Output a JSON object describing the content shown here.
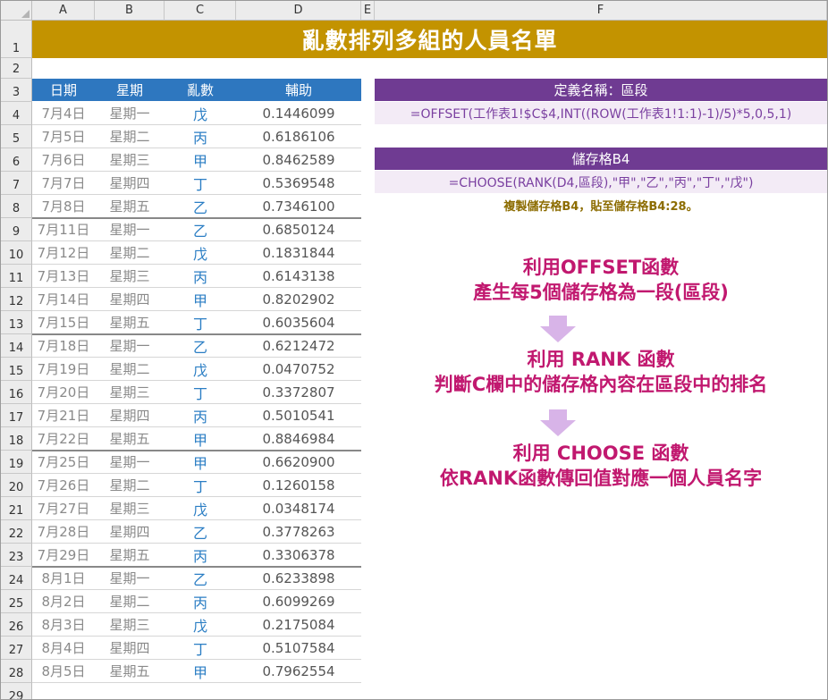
{
  "columns": [
    "A",
    "B",
    "C",
    "D",
    "E",
    "F"
  ],
  "rows": [
    "1",
    "2",
    "3",
    "4",
    "5",
    "6",
    "7",
    "8",
    "9",
    "10",
    "11",
    "12",
    "13",
    "14",
    "15",
    "16",
    "17",
    "18",
    "19",
    "20",
    "21",
    "22",
    "23",
    "24",
    "25",
    "26",
    "27",
    "28",
    "29"
  ],
  "title": "亂數排列多組的人員名單",
  "table": {
    "headers": [
      "日期",
      "星期",
      "亂數",
      "輔助"
    ],
    "rows": [
      {
        "date": "7月4日",
        "week": "星期一",
        "rand": "戊",
        "help": "0.1446099"
      },
      {
        "date": "7月5日",
        "week": "星期二",
        "rand": "丙",
        "help": "0.6186106"
      },
      {
        "date": "7月6日",
        "week": "星期三",
        "rand": "甲",
        "help": "0.8462589"
      },
      {
        "date": "7月7日",
        "week": "星期四",
        "rand": "丁",
        "help": "0.5369548"
      },
      {
        "date": "7月8日",
        "week": "星期五",
        "rand": "乙",
        "help": "0.7346100"
      },
      {
        "date": "7月11日",
        "week": "星期一",
        "rand": "乙",
        "help": "0.6850124"
      },
      {
        "date": "7月12日",
        "week": "星期二",
        "rand": "戊",
        "help": "0.1831844"
      },
      {
        "date": "7月13日",
        "week": "星期三",
        "rand": "丙",
        "help": "0.6143138"
      },
      {
        "date": "7月14日",
        "week": "星期四",
        "rand": "甲",
        "help": "0.8202902"
      },
      {
        "date": "7月15日",
        "week": "星期五",
        "rand": "丁",
        "help": "0.6035604"
      },
      {
        "date": "7月18日",
        "week": "星期一",
        "rand": "乙",
        "help": "0.6212472"
      },
      {
        "date": "7月19日",
        "week": "星期二",
        "rand": "戊",
        "help": "0.0470752"
      },
      {
        "date": "7月20日",
        "week": "星期三",
        "rand": "丁",
        "help": "0.3372807"
      },
      {
        "date": "7月21日",
        "week": "星期四",
        "rand": "丙",
        "help": "0.5010541"
      },
      {
        "date": "7月22日",
        "week": "星期五",
        "rand": "甲",
        "help": "0.8846984"
      },
      {
        "date": "7月25日",
        "week": "星期一",
        "rand": "甲",
        "help": "0.6620900"
      },
      {
        "date": "7月26日",
        "week": "星期二",
        "rand": "丁",
        "help": "0.1260158"
      },
      {
        "date": "7月27日",
        "week": "星期三",
        "rand": "戊",
        "help": "0.0348174"
      },
      {
        "date": "7月28日",
        "week": "星期四",
        "rand": "乙",
        "help": "0.3778263"
      },
      {
        "date": "7月29日",
        "week": "星期五",
        "rand": "丙",
        "help": "0.3306378"
      },
      {
        "date": "8月1日",
        "week": "星期一",
        "rand": "乙",
        "help": "0.6233898"
      },
      {
        "date": "8月2日",
        "week": "星期二",
        "rand": "丙",
        "help": "0.6099269"
      },
      {
        "date": "8月3日",
        "week": "星期三",
        "rand": "戊",
        "help": "0.2175084"
      },
      {
        "date": "8月4日",
        "week": "星期四",
        "rand": "丁",
        "help": "0.5107584"
      },
      {
        "date": "8月5日",
        "week": "星期五",
        "rand": "甲",
        "help": "0.7962554"
      }
    ]
  },
  "definition": {
    "name_header": "定義名稱：區段",
    "name_formula": "=OFFSET(工作表1!$C$4,INT((ROW(工作表1!1:1)-1)/5)*5,0,5,1)",
    "cell_header": "儲存格B4",
    "cell_formula": "=CHOOSE(RANK(D4,區段),\"甲\",\"乙\",\"丙\",\"丁\",\"戊\")",
    "note": "複製儲存格B4，貼至儲存格B4:28。"
  },
  "steps": [
    {
      "line1": "利用OFFSET函數",
      "line2": "產生每5個儲存格為一段(區段)"
    },
    {
      "line1": "利用 RANK 函數",
      "line2": "判斷C欄中的儲存格內容在區段中的排名"
    },
    {
      "line1": "利用 CHOOSE 函數",
      "line2": "依RANK函數傳回值對應一個人員名字"
    }
  ],
  "colors": {
    "title_bg": "#c39300",
    "table_header_bg": "#2e77bf",
    "def_header_bg": "#6f3b92",
    "def_body_bg": "#f3ebf6",
    "step_text": "#c1186f",
    "arrow": "#d8b4e8"
  }
}
